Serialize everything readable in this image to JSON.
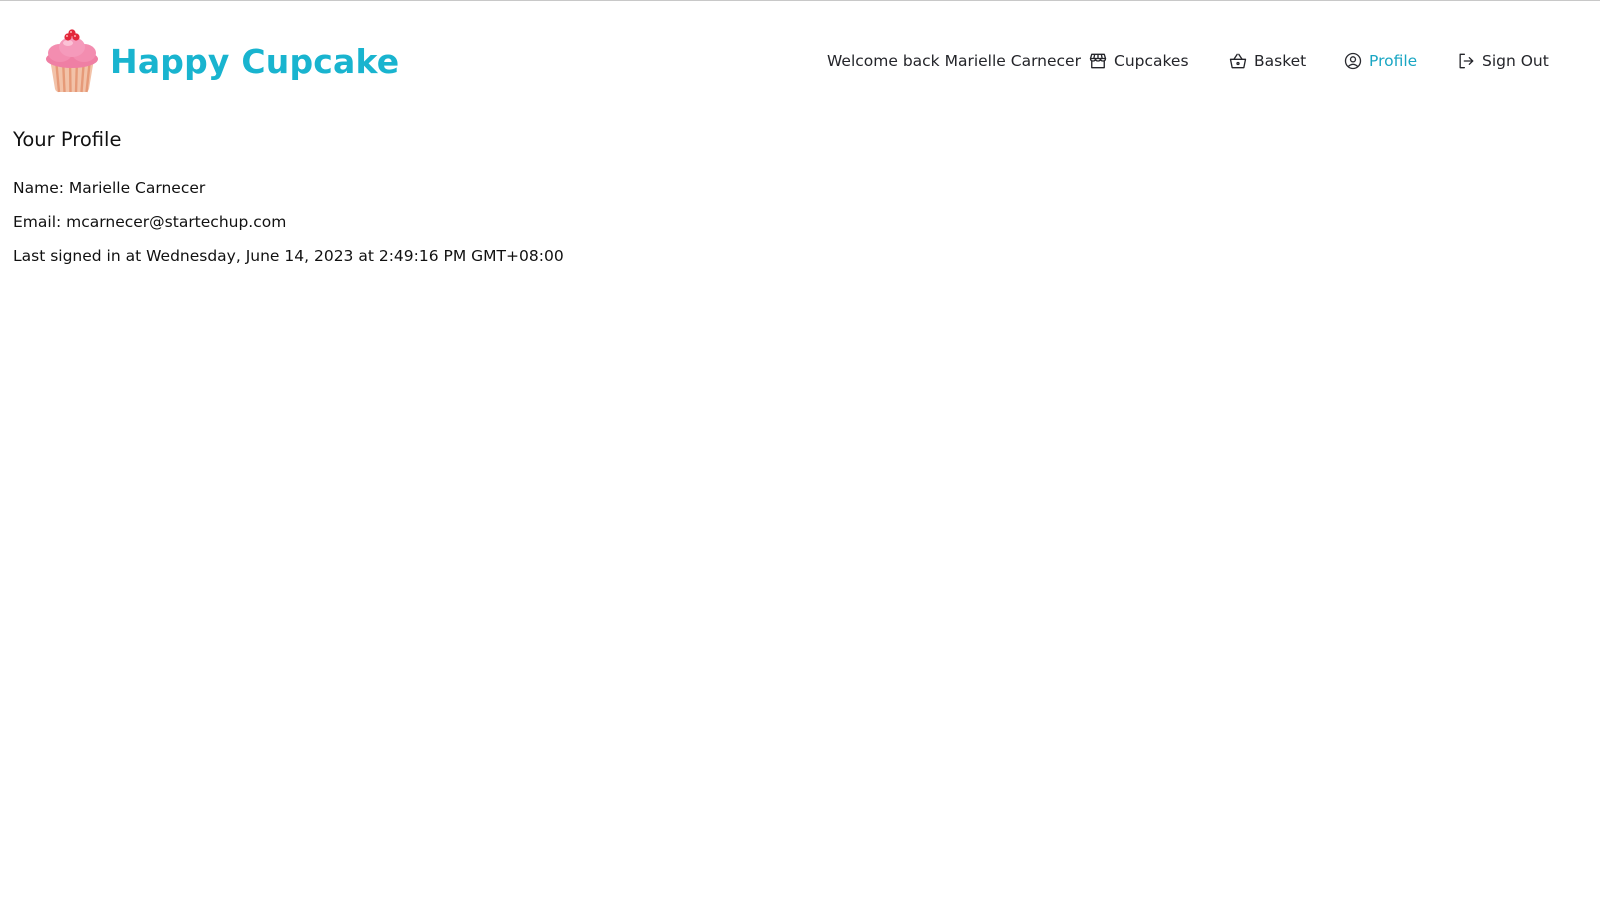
{
  "brand": {
    "name": "Happy Cupcake",
    "logo_icon": "cupcake-icon",
    "color": "#19b4cf"
  },
  "nav": {
    "welcome_text": "Welcome back Marielle Carnecer",
    "items": [
      {
        "label": "Cupcakes",
        "icon": "shop-icon",
        "active": false
      },
      {
        "label": "Basket",
        "icon": "basket-icon",
        "active": false
      },
      {
        "label": "Profile",
        "icon": "user-circle-icon",
        "active": true
      },
      {
        "label": "Sign Out",
        "icon": "sign-out-icon",
        "active": false
      }
    ],
    "active_color": "#19a6c3"
  },
  "profile": {
    "heading": "Your Profile",
    "name_line": "Name: Marielle Carnecer",
    "email_line": "Email: mcarnecer@startechup.com",
    "last_signed_in_line": "Last signed in at Wednesday, June 14, 2023 at 2:49:16 PM GMT+08:00"
  }
}
